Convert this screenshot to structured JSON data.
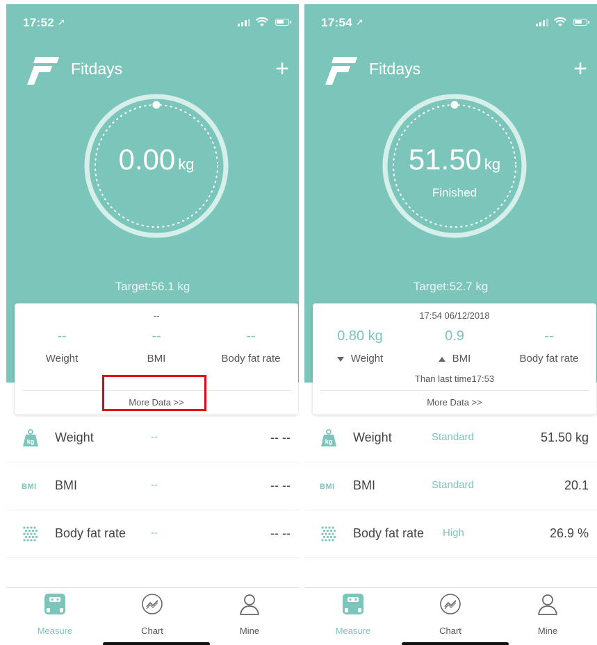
{
  "colors": {
    "brand": "#7cc5bb",
    "highlight": "#e60012"
  },
  "app": {
    "title": "Fitdays",
    "add_label": "+"
  },
  "screens": [
    {
      "status": {
        "time": "17:52"
      },
      "dial": {
        "value": "0.00",
        "unit": "kg",
        "status": ""
      },
      "target": "Target:56.1 kg",
      "card": {
        "time": "--",
        "weight_value": "--",
        "weight_label": "Weight",
        "bmi_value": "--",
        "bmi_label": "BMI",
        "fat_value": "--",
        "fat_label": "Body fat rate",
        "compare": "",
        "more_data": "More Data >>"
      },
      "rows": [
        {
          "name": "Weight",
          "status": "--",
          "value": "-- --",
          "icon": "weight-kg-icon"
        },
        {
          "name": "BMI",
          "status": "--",
          "value": "-- --",
          "icon": "bmi-icon",
          "icon_text": "BMI"
        },
        {
          "name": "Body fat rate",
          "status": "--",
          "value": "-- --",
          "icon": "body-fat-icon"
        }
      ],
      "tabs": [
        {
          "label": "Measure",
          "icon": "scale-icon"
        },
        {
          "label": "Chart",
          "icon": "chart-icon"
        },
        {
          "label": "Mine",
          "icon": "person-icon"
        }
      ]
    },
    {
      "status": {
        "time": "17:54"
      },
      "dial": {
        "value": "51.50",
        "unit": "kg",
        "status": "Finished"
      },
      "target": "Target:52.7 kg",
      "card": {
        "time": "17:54 06/12/2018",
        "weight_value": "0.80 kg",
        "weight_label": "Weight",
        "bmi_value": "0.9",
        "bmi_label": "BMI",
        "fat_value": "--",
        "fat_label": "Body fat rate",
        "compare": "Than last time17:53",
        "more_data": "More Data >>"
      },
      "rows": [
        {
          "name": "Weight",
          "status": "Standard",
          "value": "51.50 kg",
          "icon": "weight-kg-icon"
        },
        {
          "name": "BMI",
          "status": "Standard",
          "value": "20.1",
          "icon": "bmi-icon",
          "icon_text": "BMI"
        },
        {
          "name": "Body fat rate",
          "status": "High",
          "value": "26.9 %",
          "icon": "body-fat-icon"
        }
      ],
      "tabs": [
        {
          "label": "Measure",
          "icon": "scale-icon"
        },
        {
          "label": "Chart",
          "icon": "chart-icon"
        },
        {
          "label": "Mine",
          "icon": "person-icon"
        }
      ]
    }
  ]
}
